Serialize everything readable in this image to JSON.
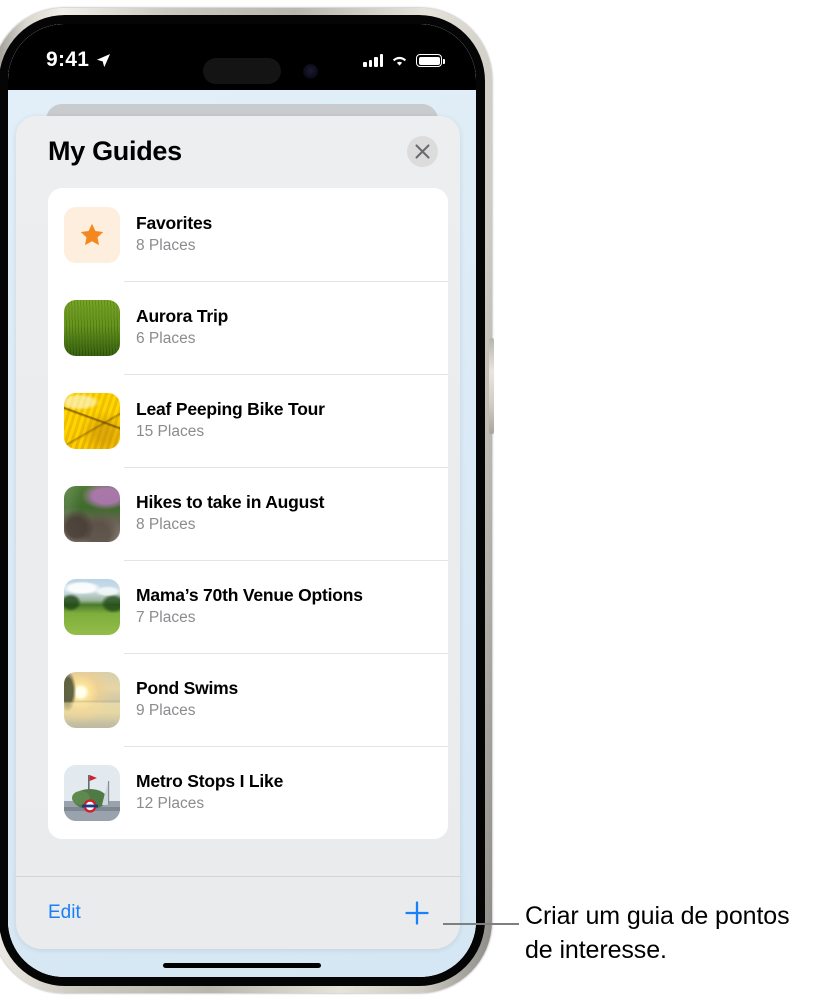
{
  "status_bar": {
    "time": "9:41",
    "location_icon": "location-arrow-icon",
    "cellular_icon": "cellular-bars-icon",
    "wifi_icon": "wifi-icon",
    "battery_icon": "battery-icon"
  },
  "sheet": {
    "title": "My Guides",
    "close_icon": "close-icon"
  },
  "guides": [
    {
      "name": "Favorites",
      "count": "8 Places",
      "thumb": "star-icon"
    },
    {
      "name": "Aurora Trip",
      "count": "6 Places",
      "thumb": "grass-photo"
    },
    {
      "name": "Leaf Peeping Bike Tour",
      "count": "15 Places",
      "thumb": "yellow-leaves-photo"
    },
    {
      "name": "Hikes to take in August",
      "count": "8 Places",
      "thumb": "forest-trail-photo"
    },
    {
      "name": "Mama’s 70th Venue Options",
      "count": "7 Places",
      "thumb": "meadow-photo"
    },
    {
      "name": "Pond Swims",
      "count": "9 Places",
      "thumb": "sunset-water-photo"
    },
    {
      "name": "Metro Stops I Like",
      "count": "12 Places",
      "thumb": "metro-station-photo"
    }
  ],
  "footer": {
    "edit_label": "Edit",
    "add_icon": "plus-icon"
  },
  "callout": {
    "text": "Criar um guia de pontos de interesse."
  },
  "colors": {
    "accent_blue": "#1a7ffb",
    "star_orange": "#f5871f",
    "sheet_bg": "#eceeef",
    "card_bg": "#ffffff",
    "subtitle_gray": "#8b8b90",
    "map_bg": "#dcebf6"
  }
}
